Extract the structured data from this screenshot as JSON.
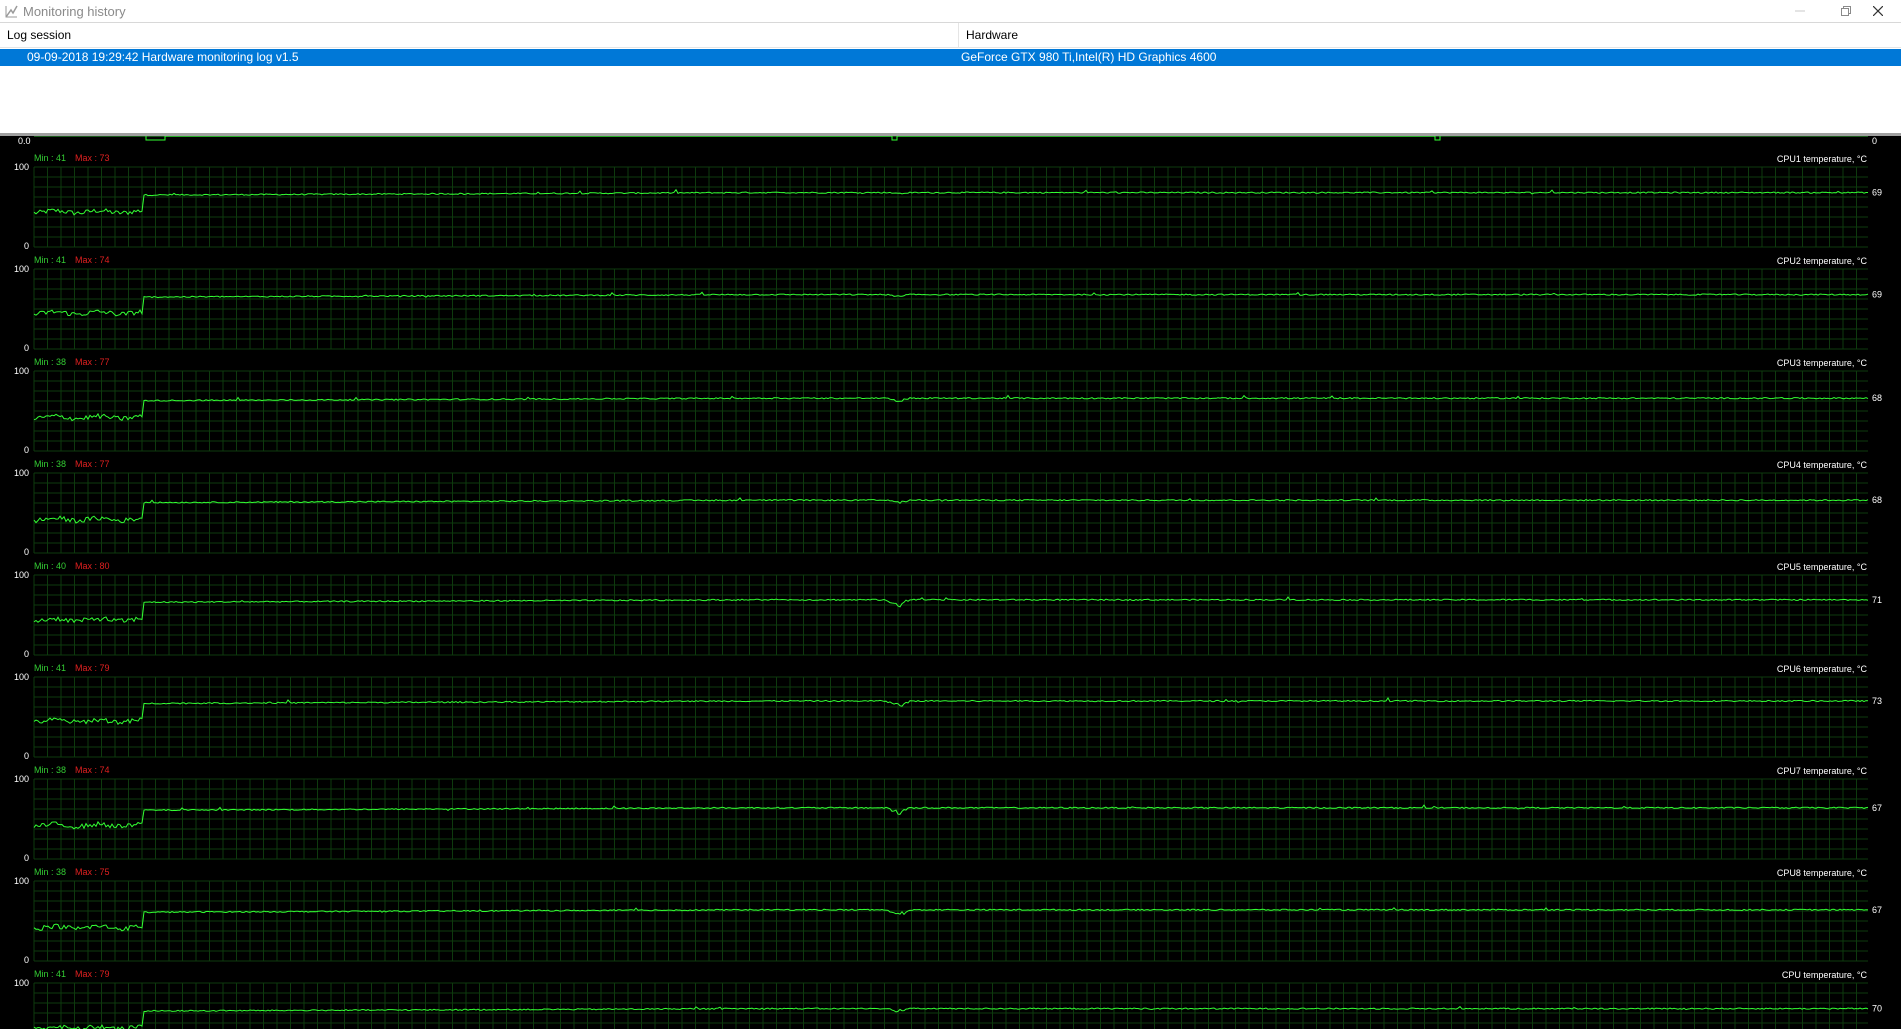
{
  "window": {
    "title": "Monitoring history",
    "title_icon": "monitoring-history-icon",
    "controls": [
      "minimize-icon",
      "restore-icon",
      "close-icon"
    ]
  },
  "log_table": {
    "headers": {
      "session": "Log session",
      "hardware": "Hardware"
    },
    "rows": [
      {
        "session": "09-09-2018 19:29:42 Hardware monitoring log v1.5",
        "hardware": "GeForce GTX 980 Ti,Intel(R) HD Graphics 4600",
        "selected": true
      }
    ]
  },
  "top_strip": {
    "left_value": "0.0",
    "right_value": "0"
  },
  "colors": {
    "graph_line": "#33ff33",
    "min_label": "#33cc33",
    "max_label": "#e02020",
    "graph_bg": "#000000",
    "grid": "#0e3a0e",
    "selection": "#0078d7"
  },
  "graphs": [
    {
      "name": "CPU1 temperature, °C",
      "min_label": "Min : 41",
      "max_label": "Max : 73",
      "y_max": "100",
      "y_min": "0",
      "current": "69",
      "base": 44,
      "level": 68,
      "dip": 2
    },
    {
      "name": "CPU2 temperature, °C",
      "min_label": "Min : 41",
      "max_label": "Max : 74",
      "y_max": "100",
      "y_min": "0",
      "current": "69",
      "base": 45,
      "level": 68,
      "dip": 2
    },
    {
      "name": "CPU3 temperature, °C",
      "min_label": "Min : 38",
      "max_label": "Max : 77",
      "y_max": "100",
      "y_min": "0",
      "current": "68",
      "base": 42,
      "level": 66,
      "dip": 4
    },
    {
      "name": "CPU4 temperature, °C",
      "min_label": "Min : 38",
      "max_label": "Max : 77",
      "y_max": "100",
      "y_min": "0",
      "current": "68",
      "base": 42,
      "level": 66,
      "dip": 4
    },
    {
      "name": "CPU5 temperature, °C",
      "min_label": "Min : 40",
      "max_label": "Max : 80",
      "y_max": "100",
      "y_min": "0",
      "current": "71",
      "base": 44,
      "level": 69,
      "dip": 8
    },
    {
      "name": "CPU6 temperature, °C",
      "min_label": "Min : 41",
      "max_label": "Max : 79",
      "y_max": "100",
      "y_min": "0",
      "current": "73",
      "base": 45,
      "level": 70,
      "dip": 8
    },
    {
      "name": "CPU7 temperature, °C",
      "min_label": "Min : 38",
      "max_label": "Max : 74",
      "y_max": "100",
      "y_min": "0",
      "current": "67",
      "base": 42,
      "level": 64,
      "dip": 8
    },
    {
      "name": "CPU8 temperature, °C",
      "min_label": "Min : 38",
      "max_label": "Max : 75",
      "y_max": "100",
      "y_min": "0",
      "current": "67",
      "base": 42,
      "level": 64,
      "dip": 8
    },
    {
      "name": "CPU temperature, °C",
      "min_label": "Min : 41",
      "max_label": "Max : 79",
      "y_max": "100",
      "y_min": "0",
      "current": "70",
      "base": 44,
      "level": 68,
      "dip": 4
    }
  ]
}
